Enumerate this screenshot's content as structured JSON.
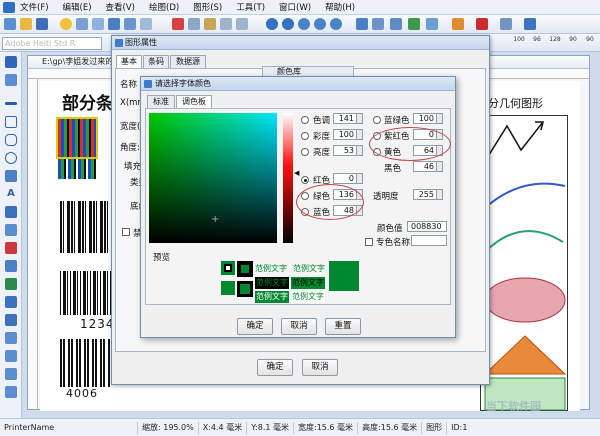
{
  "menu": {
    "items": [
      "文件(F)",
      "编辑(E)",
      "查看(V)",
      "绘图(D)",
      "图形(S)",
      "工具(T)",
      "窗口(W)",
      "帮助(H)"
    ]
  },
  "toolbar": {
    "font_name": "Adobe Heiti Std R",
    "zoom_labels": [
      "100",
      "96",
      "128",
      "90",
      "90"
    ]
  },
  "document": {
    "tab_title": "E:\\gp\\李姐发过来的",
    "heading": "部分条",
    "heading_right": "分几何图形",
    "barcode_numbers": [
      "1234",
      "4006"
    ]
  },
  "props_dialog": {
    "title": "图形属性",
    "tabs": [
      "基本",
      "条码",
      "数据源"
    ],
    "labels": {
      "name": "名称",
      "x": "X(mm",
      "width": "宽度(",
      "angle": "角度:",
      "fill": "填充",
      "type": "类型",
      "bottom": "底纹",
      "check": "禁"
    },
    "ok": "确定",
    "cancel": "取消"
  },
  "bg_panel_title": "颜色库",
  "color_dialog": {
    "title": "请选择字体颜色",
    "tabs": [
      "标准",
      "调色板"
    ],
    "fields": {
      "hue": {
        "label": "色调",
        "value": "141"
      },
      "sat": {
        "label": "彩度",
        "value": "100"
      },
      "lum": {
        "label": "亮度",
        "value": "53"
      },
      "red": {
        "label": "红色",
        "value": "0"
      },
      "green": {
        "label": "绿色",
        "value": "136"
      },
      "blue": {
        "label": "蓝色",
        "value": "48"
      },
      "cyan": {
        "label": "蓝绿色",
        "value": "100"
      },
      "magenta": {
        "label": "紫红色",
        "value": "0"
      },
      "yellow": {
        "label": "黄色",
        "value": "64"
      },
      "black": {
        "label": "黑色",
        "value": "46"
      },
      "alpha": {
        "label": "透明度",
        "value": "255"
      }
    },
    "color_value_label": "颜色值",
    "color_value": "008830",
    "color_name_label": "专色名称",
    "preview_label": "预览",
    "sample_text": "范例文字",
    "buttons": {
      "ok": "确定",
      "cancel": "取消",
      "reset": "重置"
    },
    "selected_color": "#008830"
  },
  "status": {
    "printer": "PrinterName",
    "zoom": "缩放: 195.0%",
    "x": "X:4.4 毫米",
    "y": "Y:8.1 毫米",
    "w": "宽度:15.6 毫米",
    "h": "高度:15.6 毫米",
    "type": "图形",
    "id": "ID:1"
  },
  "watermark": "当下软件园"
}
